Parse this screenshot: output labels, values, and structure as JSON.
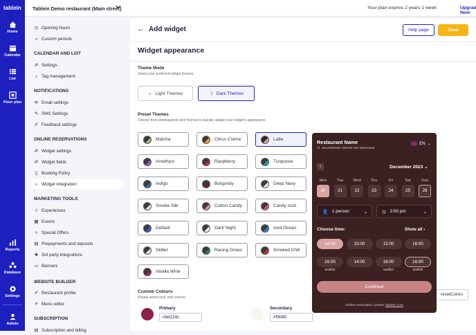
{
  "rail": {
    "logo": "tablein",
    "items": [
      {
        "label": "Home",
        "icon": "home-icon"
      },
      {
        "label": "Calendar",
        "icon": "calendar-icon"
      },
      {
        "label": "List",
        "icon": "list-icon"
      },
      {
        "label": "Floor plan",
        "icon": "floor-plan-icon"
      }
    ],
    "bottom": [
      {
        "label": "Reports",
        "icon": "reports-icon"
      },
      {
        "label": "Database",
        "icon": "database-icon"
      },
      {
        "label": "Settings",
        "icon": "settings-icon"
      },
      {
        "label": "Admin",
        "icon": "admin-icon"
      }
    ]
  },
  "topbar": {
    "restaurant": "Tablein Demo restaurant (Main street)",
    "plan_notice": "Your plan expires 2 years 1 week",
    "upgrade": "Upgrade Now"
  },
  "sidebar": {
    "sections": [
      {
        "items": [
          {
            "icon": "clock-icon",
            "label": "Opening hours"
          },
          {
            "icon": "code-icon",
            "label": "Custom periods"
          }
        ]
      },
      {
        "header": "CALENDAR AND LIST",
        "items": [
          {
            "icon": "sliders-icon",
            "label": "Settings"
          },
          {
            "icon": "tag-icon",
            "label": "Tag management"
          }
        ]
      },
      {
        "header": "NOTIFICATIONS",
        "items": [
          {
            "icon": "mail-icon",
            "label": "Email settings"
          },
          {
            "icon": "pen-icon",
            "label": "SMS Settings"
          },
          {
            "icon": "edit-icon",
            "label": "Feedback settings"
          }
        ]
      },
      {
        "header": "ONLINE RESERVATIONS",
        "items": [
          {
            "icon": "sliders-icon",
            "label": "Widget settings"
          },
          {
            "icon": "sliders-icon",
            "label": "Widget fields"
          },
          {
            "icon": "doc-icon",
            "label": "Booking Policy"
          },
          {
            "icon": "code-icon",
            "label": "Widget integration",
            "active": true
          }
        ]
      },
      {
        "header": "MARKETING TOOLS",
        "items": [
          {
            "icon": "star-icon",
            "label": "Experiences"
          },
          {
            "icon": "calendar-icon",
            "label": "Events"
          },
          {
            "icon": "gift-icon",
            "label": "Special Offers"
          },
          {
            "icon": "card-icon",
            "label": "Prepayments and deposits"
          },
          {
            "icon": "puzzle-icon",
            "label": "3rd party integrations"
          },
          {
            "icon": "banner-icon",
            "label": "Banners"
          }
        ]
      },
      {
        "header": "WEBSITE BUILDER",
        "items": [
          {
            "icon": "edit-icon",
            "label": "Restaurant profile"
          },
          {
            "icon": "menu-icon",
            "label": "Menu editor"
          }
        ]
      },
      {
        "header": "SUBSCRIPTION",
        "items": [
          {
            "icon": "card-icon",
            "label": "Subscription and billing"
          }
        ]
      }
    ]
  },
  "header": {
    "title": "Add widget",
    "help": "Help page",
    "save": "Save"
  },
  "appearance": {
    "title": "Widget appearance",
    "theme_mode": {
      "label": "Theme Mode",
      "sub": "Select your preferred widget themes",
      "light": "Light Themes",
      "dark": "Dark Themes"
    },
    "preset": {
      "label": "Preset Themes",
      "sub": "Choose from predesigned color themes to quickly update your widget's appearance",
      "themes": [
        {
          "name": "Matcha",
          "a": "#3a3a3a",
          "b": "#9cc46b"
        },
        {
          "name": "Citrus Crème",
          "a": "#3a3a3a",
          "b": "#f0a43a"
        },
        {
          "name": "Latte",
          "a": "#3b2122",
          "b": "#d9a3a3",
          "selected": true
        },
        {
          "name": "Amethyst",
          "a": "#3a3a3a",
          "b": "#9a5cd6"
        },
        {
          "name": "Raspberry",
          "a": "#3a3a3a",
          "b": "#c2264f"
        },
        {
          "name": "Turquoise",
          "a": "#3a3a3a",
          "b": "#1e9bb2"
        },
        {
          "name": "Indigo",
          "a": "#3a3a3a",
          "b": "#2a6fb0"
        },
        {
          "name": "Burgundy",
          "a": "#3a3a3a",
          "b": "#7a1e2c"
        },
        {
          "name": "Deep Navy",
          "a": "#3a3a3a",
          "b": "#e8e8ec"
        },
        {
          "name": "Smoke Silk",
          "a": "#3a3a3a",
          "b": "#e6e6e6"
        },
        {
          "name": "Cotton Candy",
          "a": "#3a3a3a",
          "b": "#e88ab2"
        },
        {
          "name": "Candy rush",
          "a": "#3a3a3a",
          "b": "#d94f8a"
        },
        {
          "name": "Default",
          "a": "#3a3a3a",
          "b": "#3b5bd9"
        },
        {
          "name": "Dark Night",
          "a": "#3a3a3a",
          "b": "#f2f2f2"
        },
        {
          "name": "Iced Ocean",
          "a": "#3a3a3a",
          "b": "#2f7fd0"
        },
        {
          "name": "Skillet",
          "a": "#3a3a3a",
          "b": "#e4e4e4"
        },
        {
          "name": "Racing Green",
          "a": "#3a3a3a",
          "b": "#1f8a4c"
        },
        {
          "name": "Smoked Chili",
          "a": "#3a3a3a",
          "b": "#b2332a"
        },
        {
          "name": "Vanilla Wine",
          "a": "#3a3a3a",
          "b": "#a0245a"
        }
      ]
    },
    "custom": {
      "label": "Custom Colours",
      "sub": "Please select your own colours",
      "primary_label": "Primary",
      "primary_value": "#8d214c",
      "primary_color": "#8d214c",
      "secondary_label": "Secondary",
      "secondary_value": "#f9f4f0",
      "secondary_color": "#f9f4f0",
      "reset": "resetColors"
    }
  },
  "preview": {
    "name": "Restaurant Name",
    "address": "Al. Jerozolimskie 195A02-222 Warszawa",
    "lang": "EN",
    "month": "December 2023",
    "days_of_week": [
      "Mon",
      "Tue",
      "Wed",
      "Thu",
      "Fri",
      "Sat",
      "Sun"
    ],
    "days": [
      "20",
      "21",
      "22",
      "23",
      "24",
      "25",
      "26"
    ],
    "people": "1 person",
    "time": "2:00 pm",
    "choose_time": "Choose time:",
    "show_all": "Show all",
    "slots": [
      "14:00",
      "15:00",
      "15:00",
      "16:00",
      "16:00",
      "14:00",
      "16:00",
      "16:00"
    ],
    "waitlist": "waitlist",
    "continue": "Continue",
    "powered_prefix": "Online reservation system ",
    "powered_link": "Tablein.com"
  }
}
